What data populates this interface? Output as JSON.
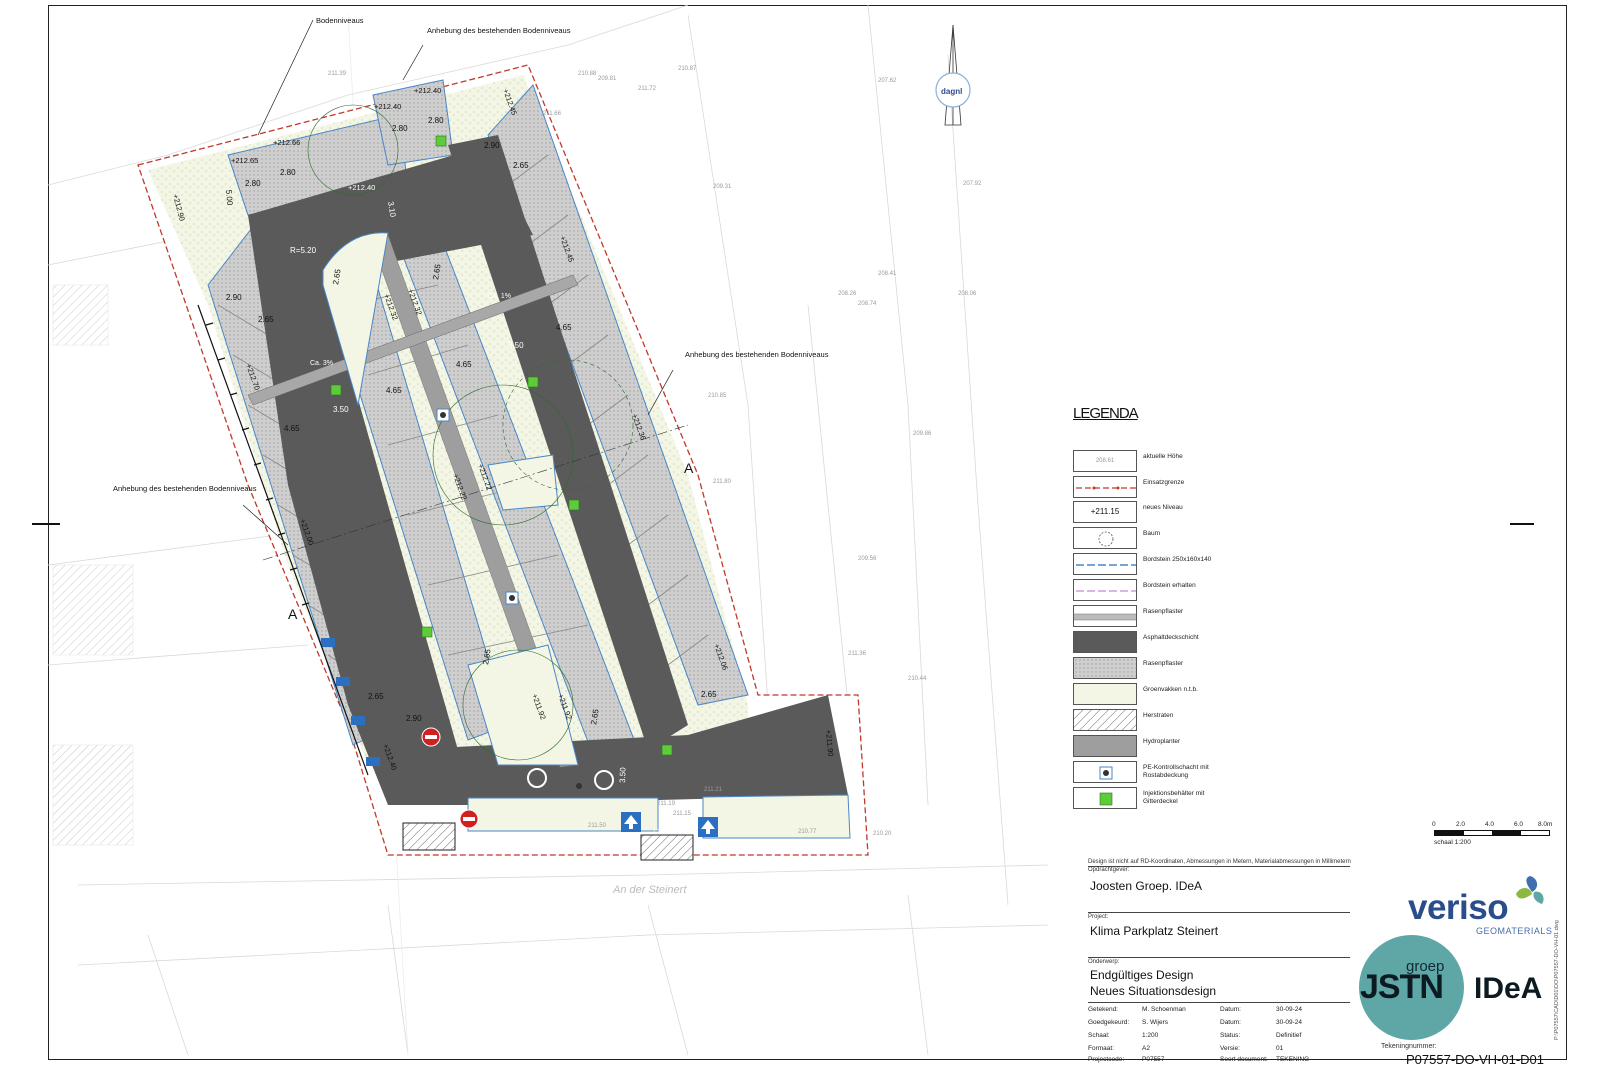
{
  "annotations": {
    "bodenniveaus": "Bodenniveaus",
    "anhebung_top": "Anhebung des bestehenden Bodenniveaus",
    "anhebung_right": "Anhebung des bestehenden Bodenniveaus",
    "anhebung_left": "Anhebung des bestehenden Bodenniveaus",
    "section_a": "A",
    "slope_1": "Ca. 1%",
    "slope_2": "Ca. 3%",
    "street_name": "An der Steinert",
    "north_logo": "dagnl"
  },
  "levels": {
    "l1": "+212.40",
    "l2": "+212.40",
    "l3": "+212.45",
    "l4": "+212.65",
    "l5": "+212.66",
    "l6": "+212.90",
    "l7": "+212.40",
    "l8": "+212.45",
    "l9": "+212.32",
    "l10": "+212.32",
    "l11": "+212.22",
    "l12": "+212.22",
    "l13": "+212.36",
    "l14": "+212.00",
    "l15": "+212.70",
    "l16": "+211.92",
    "l17": "+211.92",
    "l18": "+212.06",
    "l19": "+212.40",
    "l20": "+212.15",
    "l21": "+212.10",
    "l22": "+211.90"
  },
  "dimensions": {
    "d280a": "2.80",
    "d280b": "2.80",
    "d280c": "2.80",
    "d280d": "2.80",
    "d500": "5.00",
    "d290a": "2.90",
    "d290b": "2.90",
    "d290c": "2.90",
    "d265a": "2.65",
    "d265b": "2.65",
    "d265c": "2.65",
    "d265d": "2.65",
    "d265e": "2.65",
    "d265f": "2.65",
    "d265g": "2.65",
    "d265h": "2.65",
    "d465a": "4.65",
    "d465b": "4.65",
    "d465c": "4.65",
    "d465d": "4.65",
    "d350a": "3.50",
    "d350b": "3.50",
    "d350c": "3.50",
    "d520": "R=5.20",
    "d310": "3.10"
  },
  "spot_heights": {
    "h1": "209.81",
    "h2": "211.72",
    "h3": "210.87",
    "h4": "211.66",
    "h5": "209.31",
    "h6": "211.21",
    "h7": "211.19",
    "h8": "211.15",
    "h9": "211.50",
    "h10": "210.77",
    "h11": "211.36",
    "h12": "210.44",
    "h13": "209.86",
    "h14": "208.41",
    "h15": "208.74",
    "h16": "207.62",
    "h17": "207.92",
    "h18": "208.06",
    "h19": "210.88",
    "h20": "211.39",
    "h21": "210.85",
    "h22": "211.80",
    "h23": "209.56",
    "h24": "208.26",
    "h25": "210.20"
  },
  "legend": {
    "title": "LEGENDA",
    "items": [
      {
        "label": "aktuelle Höhe",
        "sample": "208.61"
      },
      {
        "label": "Einsatzgrenze"
      },
      {
        "label": "neues Niveau",
        "sample": "+211.15"
      },
      {
        "label": "Baum"
      },
      {
        "label": "Bordstein 250x160x140"
      },
      {
        "label": "Bordstein erhalten"
      },
      {
        "label": "Rasenpflaster"
      },
      {
        "label": "Asphaltdeckschicht"
      },
      {
        "label": "Rasenpflaster"
      },
      {
        "label": "Groenvakken n.t.b."
      },
      {
        "label": "Herstraten"
      },
      {
        "label": "Hydroplanter"
      },
      {
        "label": "PE-Kontrollschacht mit Rostabdeckung"
      },
      {
        "label": "Injektionsbehälter mit Gitterdeckel"
      }
    ]
  },
  "scale_bar": {
    "ticks": [
      "0",
      "2.0",
      "4.0",
      "6.0",
      "8.0m"
    ],
    "label": "schaal 1:200"
  },
  "title_block": {
    "notice": "Design ist nicht auf RD-Koordinaten, Abmessungen in Metern, Materialabmessungen in Millimetern",
    "client_label": "Opdrachtgever:",
    "client": "Joosten Groep. IDeA",
    "project_label": "Project:",
    "project": "Klima Parkplatz Steinert",
    "subject_label": "Onderwerp:",
    "subject_line1": "Endgültiges Design",
    "subject_line2": "Neues Situationsdesign",
    "rows": [
      {
        "k1": "Getekend:",
        "v1": "M. Schoenman",
        "k2": "Datum:",
        "v2": "30-09-24"
      },
      {
        "k1": "Goedgekeurd:",
        "v1": "S. Wijers",
        "k2": "Datum:",
        "v2": "30-09-24"
      },
      {
        "k1": "Schaal:",
        "v1": "1:200",
        "k2": "Status:",
        "v2": "Definitief"
      },
      {
        "k1": "Formaat:",
        "v1": "A2",
        "k2": "Versie:",
        "v2": "01"
      },
      {
        "k1": "Projectcode:",
        "v1": "P07557",
        "k2": "Soort document:",
        "v2": "TEKENING"
      }
    ],
    "docnum_label": "Tekeningnummer:",
    "docnum": "P07557-DO-VH-01-D01",
    "side_path": "P:\\P07557\\CAD\\D01\\DO\\P07557-DO-VH-01.dwg"
  },
  "brand": {
    "veriso": "veriso",
    "veriso_sub": "GEOMATERIALS",
    "groep": "groep",
    "jstn": "JSTN",
    "idea": "IDeA"
  },
  "colors": {
    "asphalt": "#5a5a5a",
    "paver": "#c9c9c9",
    "hydroplanter": "#9e9e9e",
    "green_area": "#f3f6e4",
    "boundary_red": "#c0392b",
    "curb_blue": "#4a86c8",
    "injection_green": "#5ecb3a",
    "parking_blue": "#2b6fc2"
  }
}
